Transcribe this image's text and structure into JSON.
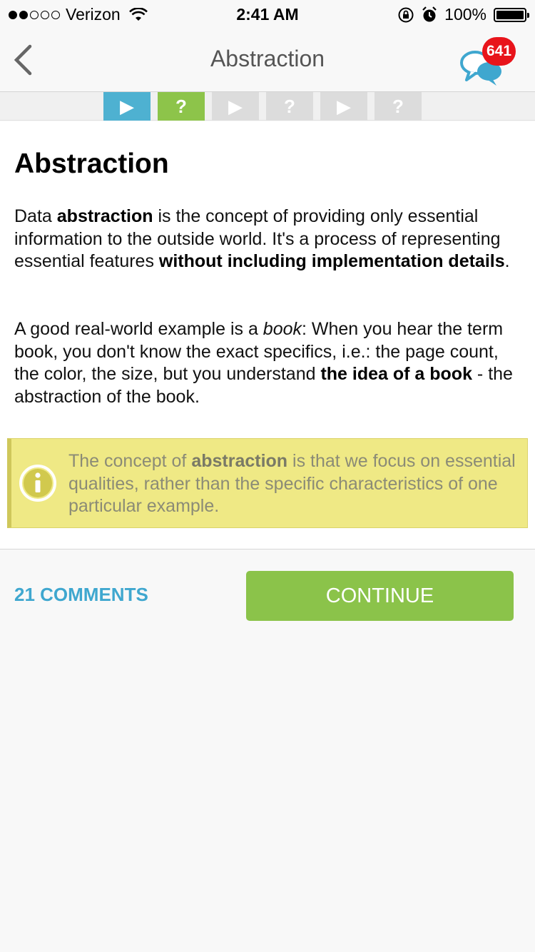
{
  "status_bar": {
    "carrier": "Verizon",
    "time": "2:41 AM",
    "battery": "100%",
    "signal_bars": 2
  },
  "nav": {
    "title": "Abstraction",
    "back_icon": "chevron-left-icon",
    "chat_icon": "chat-bubbles-icon",
    "chat_badge": "641"
  },
  "progress": {
    "steps": [
      {
        "kind": "lesson",
        "glyph": "▶",
        "state": "done"
      },
      {
        "kind": "quiz",
        "glyph": "?",
        "state": "done"
      },
      {
        "kind": "lesson",
        "glyph": "▶",
        "state": "pending"
      },
      {
        "kind": "quiz",
        "glyph": "?",
        "state": "pending"
      },
      {
        "kind": "lesson",
        "glyph": "▶",
        "state": "pending"
      },
      {
        "kind": "quiz",
        "glyph": "?",
        "state": "pending"
      }
    ]
  },
  "lesson": {
    "title": "Abstraction",
    "para1": {
      "t1": "Data ",
      "b1": "abstraction",
      "t2": " is the concept of providing only essential information to the outside world. It's a process of representing essential features ",
      "b2": "without including implementation details",
      "t3": "."
    },
    "para2": {
      "t1": "A good real-world example is a ",
      "i1": "book",
      "t2": ": When you hear the term book, you don't know the exact specifics, i.e.: the page count, the color, the size, but you understand ",
      "b1": "the idea of a book",
      "t3": " - the abstraction of the book."
    },
    "note": {
      "t1": "The concept of ",
      "b1": "abstraction",
      "t2": " is that we focus on essential qualities, rather than the specific characteristics of one particular example."
    }
  },
  "footer": {
    "comments_label": "21 COMMENTS",
    "continue_label": "CONTINUE"
  },
  "colors": {
    "accent_blue": "#4eb1d1",
    "accent_green": "#8bc34a",
    "badge_red": "#e8141b",
    "note_yellow": "#efe985"
  }
}
